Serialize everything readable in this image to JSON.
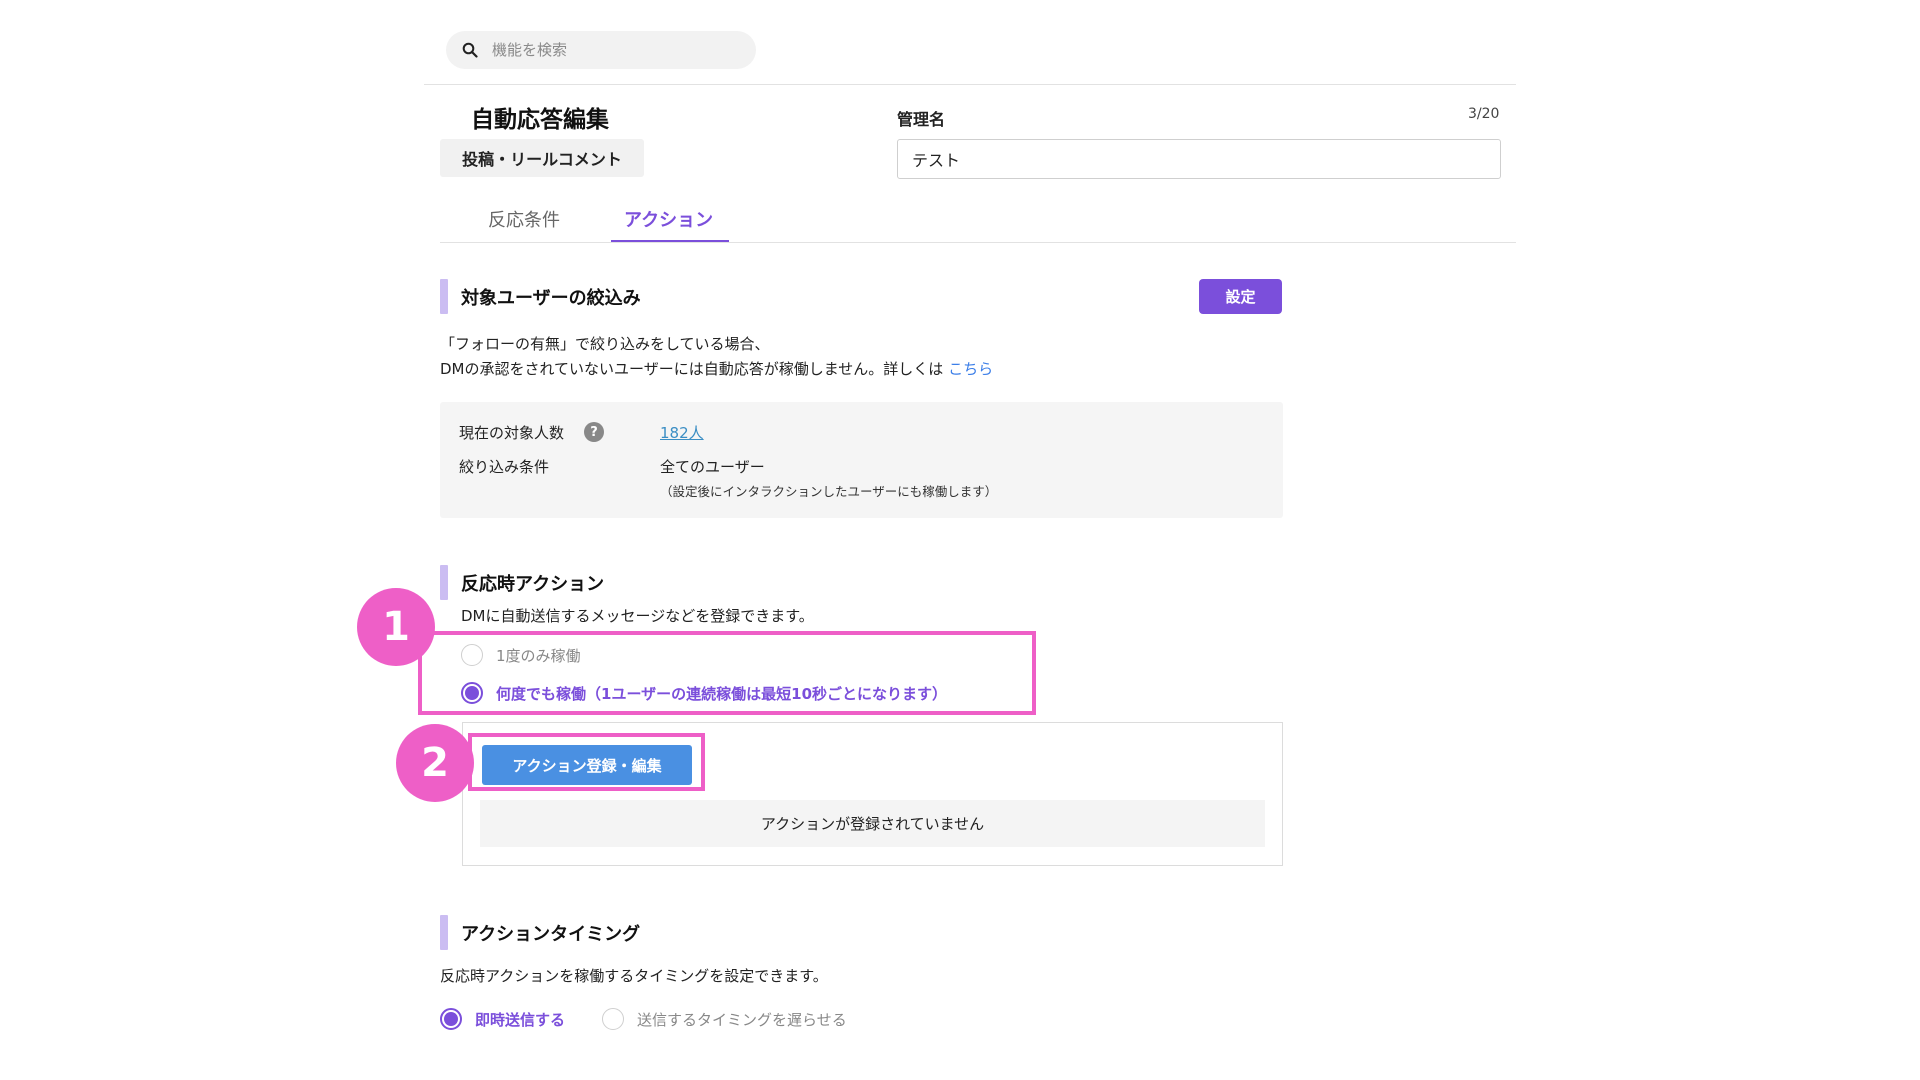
{
  "search": {
    "placeholder": "機能を検索",
    "icon": "search-icon"
  },
  "header": {
    "title": "自動応答編集",
    "type_chip": "投稿・リールコメント",
    "name_label": "管理名",
    "name_counter": "3/20",
    "name_value": "テスト"
  },
  "tabs": [
    {
      "label": "反応条件",
      "active": false
    },
    {
      "label": "アクション",
      "active": true
    }
  ],
  "target_users": {
    "title": "対象ユーザーの絞込み",
    "settings_button": "設定",
    "desc_line1": "「フォローの有無」で絞り込みをしている場合、",
    "desc_line2": "DMの承認をされていないユーザーには自動応答が稼働しません。詳しくは",
    "desc_link": "こちら",
    "count_label": "現在の対象人数",
    "help": "?",
    "count_value": "182人",
    "filter_label": "絞り込み条件",
    "filter_value": "全てのユーザー",
    "filter_note": "（設定後にインタラクションしたユーザーにも稼働します）"
  },
  "reaction_action": {
    "title": "反応時アクション",
    "desc": "DMに自動送信するメッセージなどを登録できます。",
    "options": [
      {
        "label": "1度のみ稼働",
        "selected": false
      },
      {
        "label": "何度でも稼働（1ユーザーの連続稼働は最短10秒ごとになります）",
        "selected": true
      }
    ],
    "register_button": "アクション登録・編集",
    "empty_text": "アクションが登録されていません"
  },
  "annotations": {
    "badge1": "1",
    "badge2": "2",
    "color": "#ee5fc7"
  },
  "timing": {
    "title": "アクションタイミング",
    "desc": "反応時アクションを稼働するタイミングを設定できます。",
    "options": [
      {
        "label": "即時送信する",
        "selected": true
      },
      {
        "label": "送信するタイミングを遅らせる",
        "selected": false
      }
    ]
  },
  "colors": {
    "accent": "#7b4fdb",
    "action_button": "#4a90e2",
    "link": "#3b7ee8",
    "highlight": "#ee5fc7"
  }
}
